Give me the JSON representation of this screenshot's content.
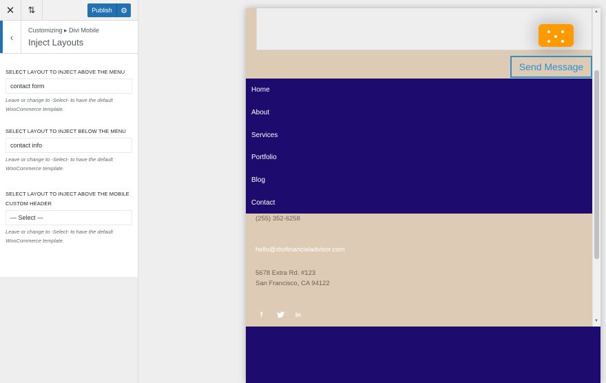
{
  "toolbar": {
    "close_icon": "✕",
    "reorder_icon": "⇅",
    "publish_label": "Publish",
    "settings_icon": "⚙"
  },
  "section": {
    "back_icon": "‹",
    "breadcrumb": "Customizing ▸ Divi Mobile",
    "title": "Inject Layouts"
  },
  "controls": [
    {
      "label": "Select layout to inject above the menu",
      "value": "contact form",
      "description": "Leave or change to -Select- to have the default WooCommerce template."
    },
    {
      "label": "Select layout to inject below the menu",
      "value": "contact info",
      "description": "Leave or change to -Select- to have the default WooCommerce template."
    },
    {
      "label": "Select layout to inject above the mobile custom header",
      "value": "— Select —",
      "description": "Leave or change to -Select- to have the default WooCommerce template."
    }
  ],
  "preview": {
    "send_button": "Send Message",
    "menu": [
      "Home",
      "About",
      "Services",
      "Portfolio",
      "Blog",
      "Contact"
    ],
    "phone": "(255) 352-6258",
    "email": "hello@divifinancialadvisor.com",
    "address_line1": "5678 Extra Rd. #123",
    "address_line2": "San Francisco, CA 94122",
    "social": {
      "facebook": "f",
      "twitter": "🐦",
      "linkedin": "in"
    }
  },
  "colors": {
    "accent": "#2271b1",
    "menu_bg": "#1d0c6e",
    "section_bg": "#decbb5",
    "captcha": "#ff9b00",
    "send_button": "#2e8fd0"
  }
}
